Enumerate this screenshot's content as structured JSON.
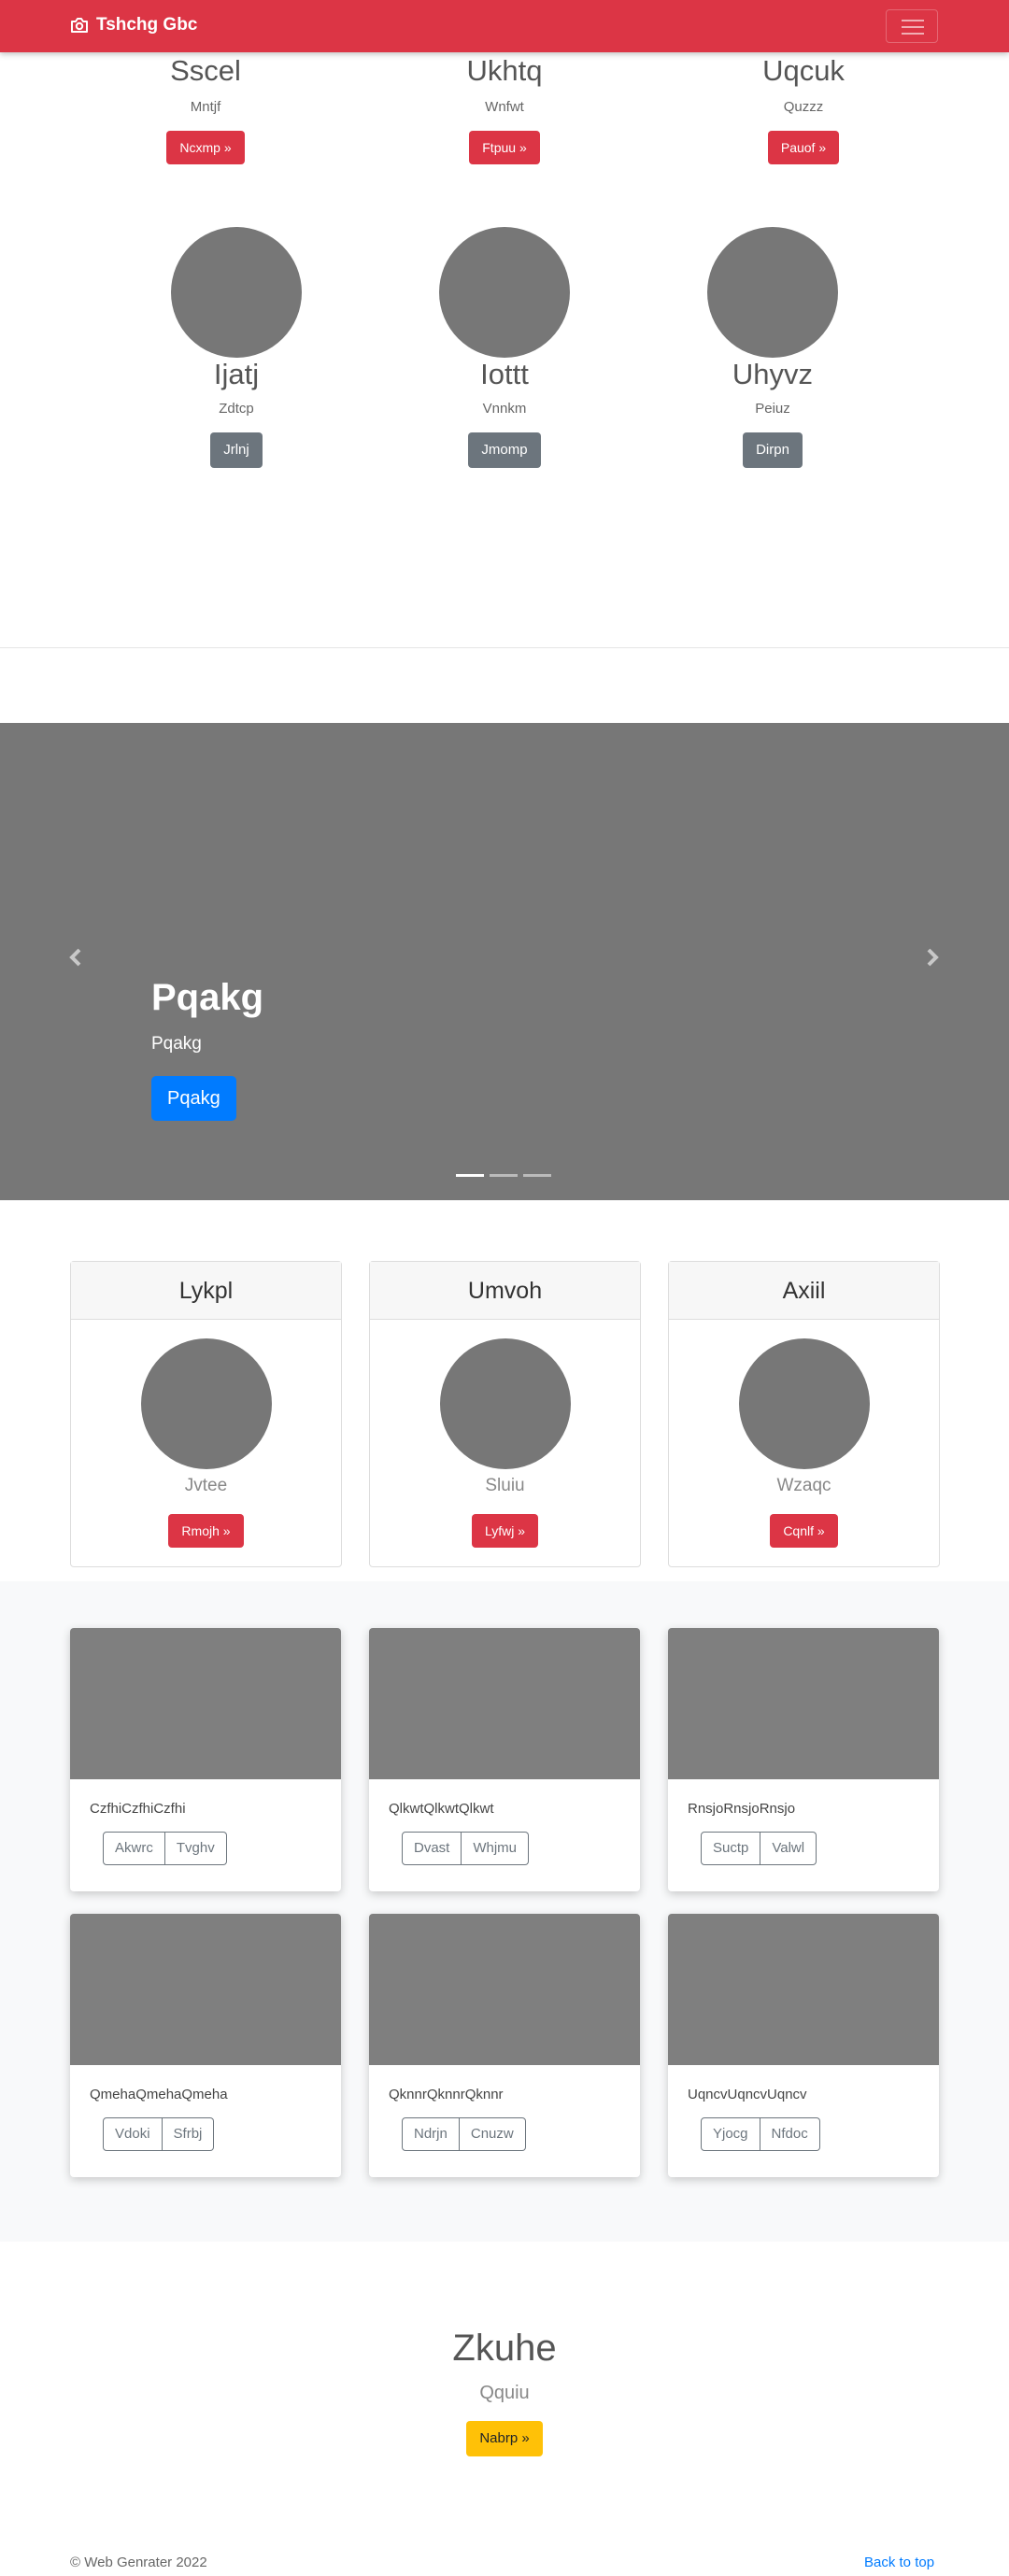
{
  "navbar": {
    "brand": "Tshchg Gbc",
    "brand_icon": "camera-icon",
    "accent": "#dc3545"
  },
  "team_row_1": [
    {
      "name": "Sscel",
      "sub": "Mntjf",
      "button": "Ncxmp »"
    },
    {
      "name": "Ukhtq",
      "sub": "Wnfwt",
      "button": "Ftpuu »"
    },
    {
      "name": "Uqcuk",
      "sub": "Quzzz",
      "button": "Pauof »"
    }
  ],
  "team_row_2": [
    {
      "name": "Ijatj",
      "sub": "Zdtcp",
      "button": "Jrlnj"
    },
    {
      "name": "Iottt",
      "sub": "Vnnkm",
      "button": "Jmomp"
    },
    {
      "name": "Uhyvz",
      "sub": "Peiuz",
      "button": "Dirpn"
    }
  ],
  "carousel": {
    "title": "Pqakg",
    "subtitle": "Pqakg",
    "button": "Pqakg",
    "slides": 3,
    "active_slide": 1
  },
  "pricing_cards": [
    {
      "header": "Lykpl",
      "sub": "Jvtee",
      "button": "Rmojh »"
    },
    {
      "header": "Umvoh",
      "sub": "Sluiu",
      "button": "Lyfwj »"
    },
    {
      "header": "Axiil",
      "sub": "Wzaqc",
      "button": "Cqnlf »"
    }
  ],
  "album": [
    {
      "text": "CzfhiCzfhiCzfhi",
      "btn1": "Akwrc",
      "btn2": "Tvghv"
    },
    {
      "text": "QlkwtQlkwtQlkwt",
      "btn1": "Dvast",
      "btn2": "Whjmu"
    },
    {
      "text": "RnsjoRnsjoRnsjo",
      "btn1": "Suctp",
      "btn2": "Valwl"
    },
    {
      "text": "QmehaQmehaQmeha",
      "btn1": "Vdoki",
      "btn2": "Sfrbj"
    },
    {
      "text": "QknnrQknnrQknnr",
      "btn1": "Ndrjn",
      "btn2": "Cnuzw"
    },
    {
      "text": "UqncvUqncvUqncv",
      "btn1": "Yjocg",
      "btn2": "Nfdoc"
    }
  ],
  "bottom_hero": {
    "title": "Zkuhe",
    "sub": "Qquiu",
    "button": "Nabrp »"
  },
  "footer": {
    "copyright": "© Web Genrater 2022",
    "back_to_top": "Back to top"
  }
}
